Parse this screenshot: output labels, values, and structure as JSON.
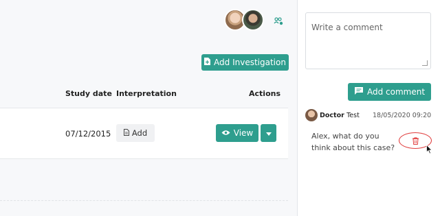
{
  "header": {
    "add_investigation_label": "Add Investigation"
  },
  "table": {
    "columns": [
      "Study date",
      "Interpretation",
      "Actions"
    ],
    "rows": [
      {
        "study_date": "07/12/2015",
        "interpretation_button": "Add",
        "view_button": "View"
      }
    ]
  },
  "comments": {
    "placeholder": "Write a comment",
    "add_comment_label": "Add comment",
    "items": [
      {
        "author_first": "Doctor",
        "author_last": "Test",
        "date": "18/05/2020 09:20",
        "text": "Alex, what do you think about this case?"
      }
    ]
  },
  "colors": {
    "accent": "#2e9e8e",
    "delete_highlight": "#e03a3a"
  },
  "icons": [
    "file-plus-icon",
    "file-icon",
    "eye-icon",
    "caret-down-icon",
    "comment-icon",
    "trash-icon",
    "group-settings-icon"
  ]
}
